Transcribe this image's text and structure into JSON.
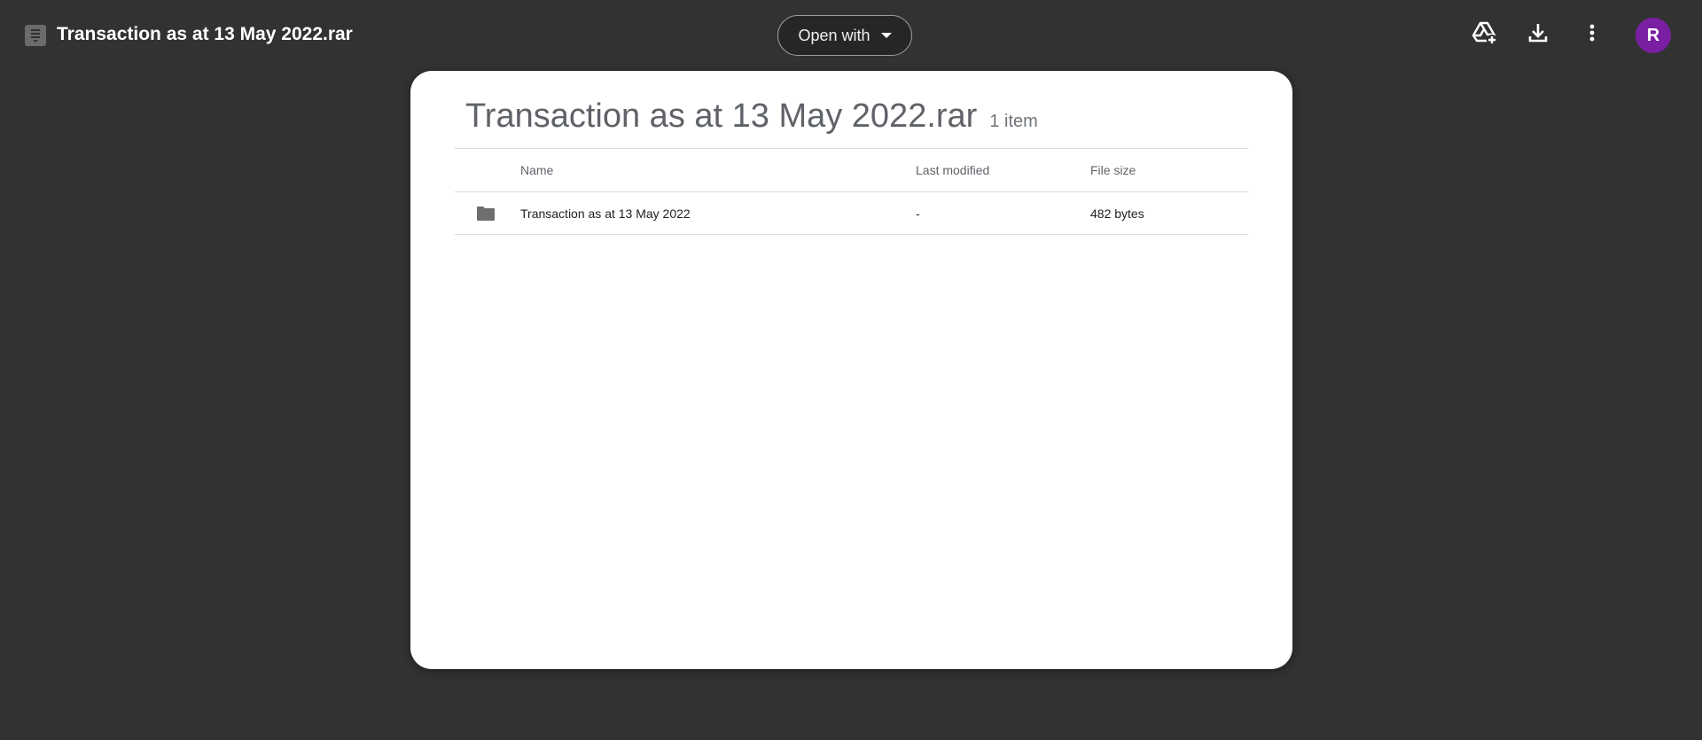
{
  "header": {
    "title": "Transaction as at 13 May 2022.rar",
    "open_with_label": "Open with",
    "avatar_initial": "R",
    "avatar_color": "#7b1fa2",
    "icons": [
      "archive-file-icon",
      "add-to-drive-icon",
      "download-icon",
      "more-vert-icon"
    ]
  },
  "archive": {
    "title": "Transaction as at 13 May 2022.rar",
    "item_count": "1 item",
    "columns": {
      "name": "Name",
      "last_modified": "Last modified",
      "file_size": "File size"
    },
    "rows": [
      {
        "icon": "folder-icon",
        "name": "Transaction as at 13 May 2022",
        "last_modified": "-",
        "file_size": "482 bytes"
      }
    ]
  }
}
